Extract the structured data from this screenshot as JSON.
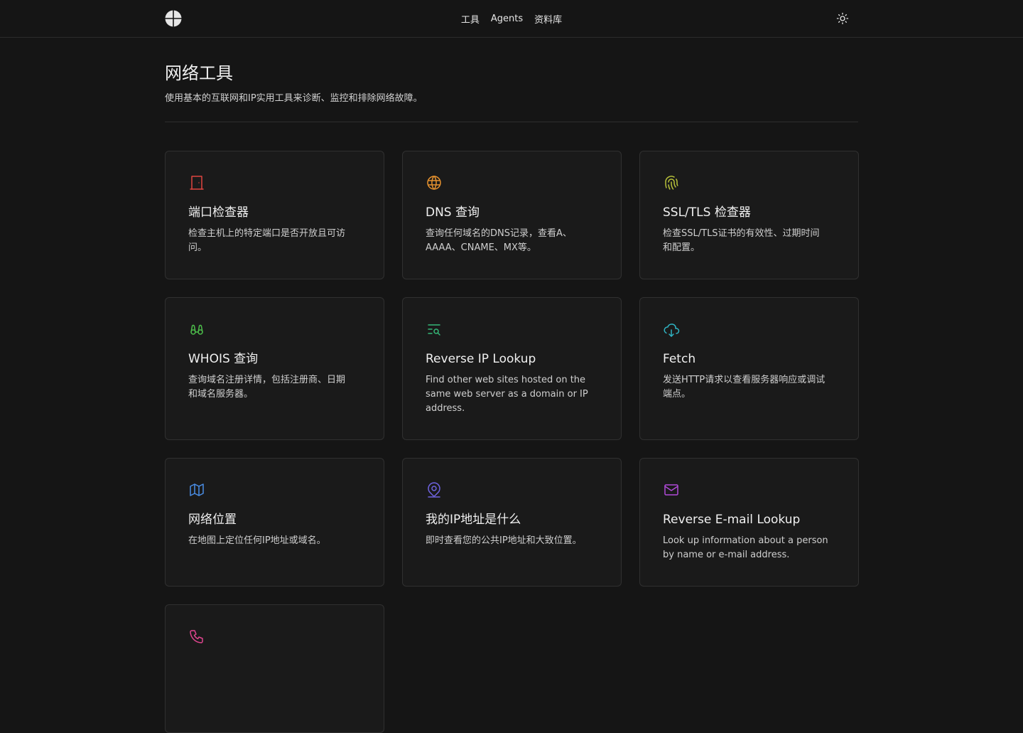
{
  "header": {
    "nav": [
      {
        "label": "工具"
      },
      {
        "label": "Agents"
      },
      {
        "label": "资料库"
      }
    ]
  },
  "page": {
    "title": "网络工具",
    "subtitle": "使用基本的互联网和IP实用工具来诊断、监控和排除网络故障。"
  },
  "tools": [
    {
      "title": "端口检查器",
      "description": "检查主机上的特定端口是否开放且可访问。",
      "icon": "door-icon",
      "color": "#e0453f"
    },
    {
      "title": "DNS 查询",
      "description": "查询任何域名的DNS记录，查看A、AAAA、CNAME、MX等。",
      "icon": "globe-icon",
      "color": "#e6922e"
    },
    {
      "title": "SSL/TLS 检查器",
      "description": "检查SSL/TLS证书的有效性、过期时间和配置。",
      "icon": "fingerprint-icon",
      "color": "#b8c23a"
    },
    {
      "title": "WHOIS 查询",
      "description": "查询域名注册详情，包括注册商、日期和域名服务器。",
      "icon": "binoculars-icon",
      "color": "#4cbb4a"
    },
    {
      "title": "Reverse IP Lookup",
      "description": "Find other web sites hosted on the same web server as a domain or IP address.",
      "icon": "list-search-icon",
      "color": "#35b877"
    },
    {
      "title": "Fetch",
      "description": "发送HTTP请求以查看服务器响应或调试端点。",
      "icon": "cloud-download-icon",
      "color": "#2fb3c2"
    },
    {
      "title": "网络位置",
      "description": "在地图上定位任何IP地址或域名。",
      "icon": "map-icon",
      "color": "#4a8ee6"
    },
    {
      "title": "我的IP地址是什么",
      "description": "即时查看您的公共IP地址和大致位置。",
      "icon": "map-pin-icon",
      "color": "#6f63e0"
    },
    {
      "title": "Reverse E-mail Lookup",
      "description": "Look up information about a person by name or e-mail address.",
      "icon": "mail-icon",
      "color": "#b04ad8"
    },
    {
      "title": "",
      "description": "",
      "icon": "phone-icon",
      "color": "#e0458f"
    }
  ]
}
